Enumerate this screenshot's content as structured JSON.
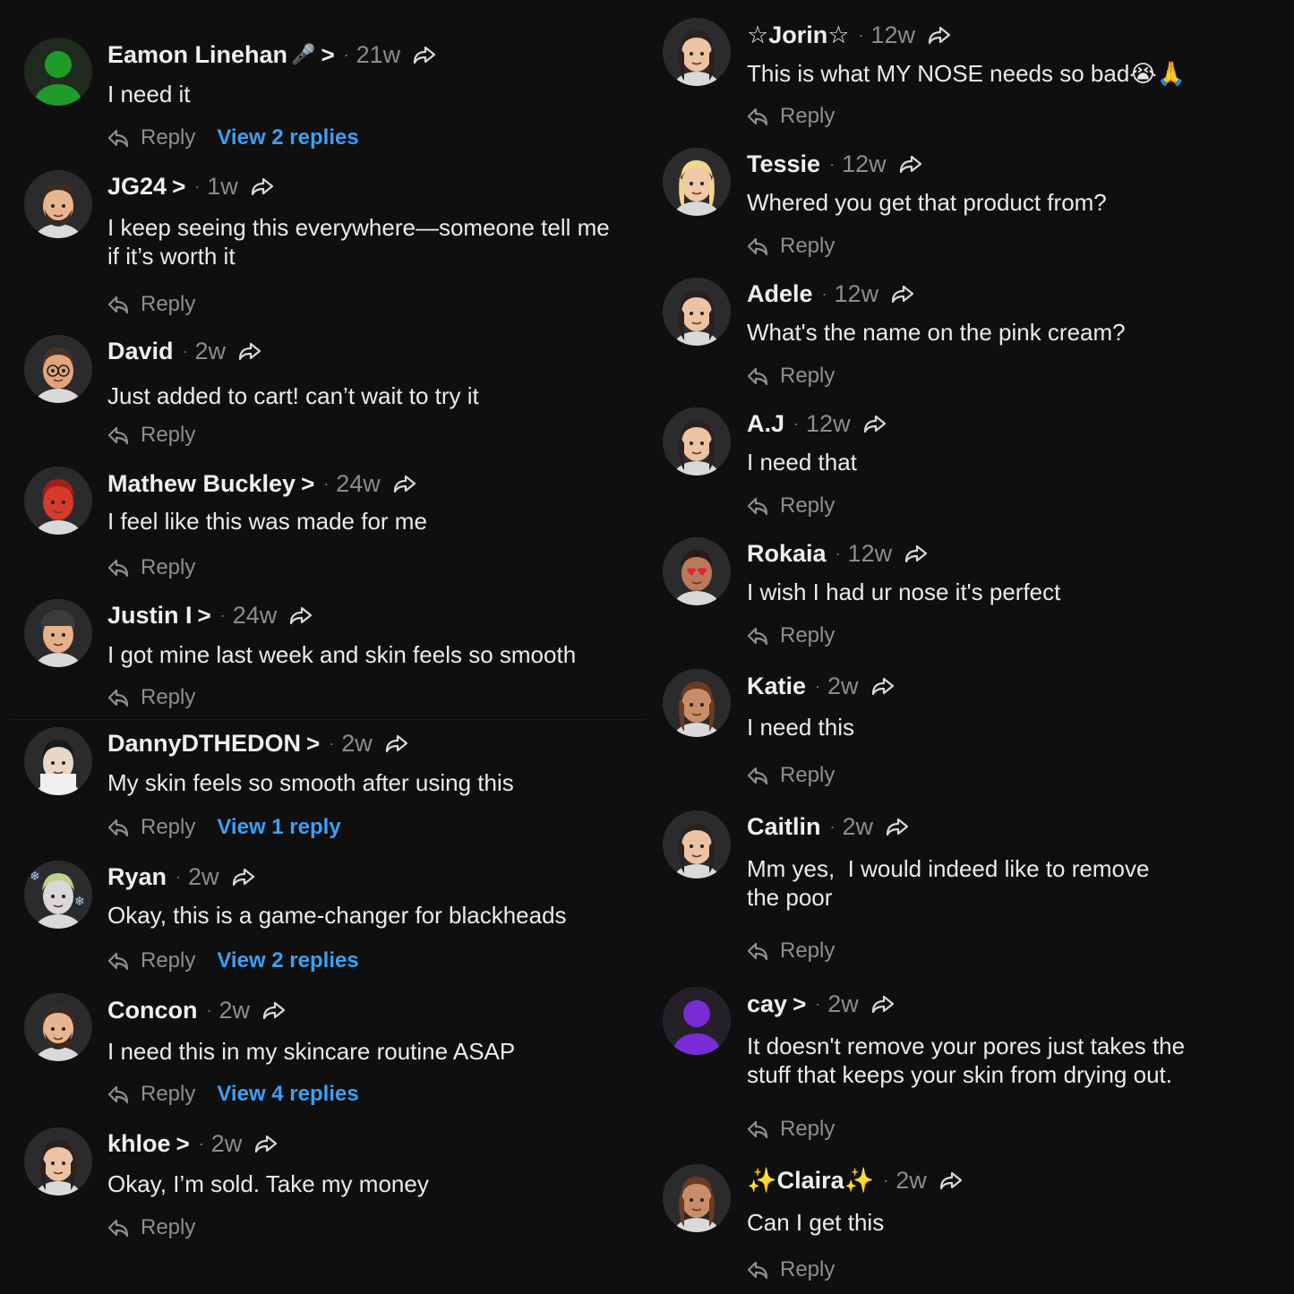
{
  "actions": {
    "reply_label": "Reply"
  },
  "colors": {
    "background": "#0f0f10",
    "name": "#efefef",
    "muted": "#8e8e92",
    "link": "#3ba0f5"
  },
  "left_comments": [
    {
      "name": "Eamon Linehan",
      "badge": "🎤",
      "chevron": ">",
      "time": "21w",
      "text": "I need it",
      "view_label": "View 2 replies",
      "avatar": "green-silhouette"
    },
    {
      "name": "JG24",
      "chevron": ">",
      "time": "1w",
      "text": "I keep seeing this everywhere—someone tell me\nif it’s worth it",
      "avatar": "bearded-man"
    },
    {
      "name": "David",
      "time": "2w",
      "text": "Just added to cart! can’t wait to try it",
      "avatar": "man-glasses"
    },
    {
      "name": "Mathew Buckley",
      "chevron": ">",
      "time": "24w",
      "text": "I feel like this was made for me",
      "avatar": "red-avatar"
    },
    {
      "name": "Justin I",
      "chevron": ">",
      "time": "24w",
      "text": "I got mine last week and skin feels so smooth",
      "avatar": "man-cap"
    },
    {
      "name": "DannyDTHEDON",
      "chevron": ">",
      "time": "2w",
      "text": "My skin feels so smooth after using this",
      "view_label": "View 1 reply",
      "avatar": "photo-man"
    },
    {
      "name": "Ryan",
      "time": "2w",
      "text": "Okay, this is a game-changer for blackheads",
      "view_label": "View 2 replies",
      "avatar": "snow-avatar"
    },
    {
      "name": "Concon",
      "time": "2w",
      "text": "I need this in my skincare routine ASAP",
      "view_label": "View 4 replies",
      "avatar": "bearded-man"
    },
    {
      "name": "khloe",
      "chevron": ">",
      "time": "2w",
      "text": "Okay, I’m sold. Take my money",
      "avatar": "woman-dark-hair"
    }
  ],
  "right_comments": [
    {
      "name": "☆Jorin☆",
      "time": "12w",
      "text": "This is what MY NOSE needs so bad😭🙏",
      "avatar": "woman-dark-hair"
    },
    {
      "name": "Tessie",
      "time": "12w",
      "text": "Whered you get that product from?",
      "avatar": "woman-blonde"
    },
    {
      "name": "Adele",
      "time": "12w",
      "text": "What's the name on the pink cream?",
      "avatar": "woman-dark-hair"
    },
    {
      "name": "A.J",
      "time": "12w",
      "text": "I need that",
      "avatar": "woman-dark-hair"
    },
    {
      "name": "Rokaia",
      "time": "12w",
      "text": "I wish I had ur nose it's perfect",
      "avatar": "heart-eyes"
    },
    {
      "name": "Katie",
      "time": "2w",
      "text": "I need this",
      "avatar": "woman-brown"
    },
    {
      "name": "Caitlin",
      "time": "2w",
      "text": "Mm yes,  I would indeed like to remove\nthe poor",
      "avatar": "woman-dark-hair"
    },
    {
      "name": "cay",
      "chevron": ">",
      "time": "2w",
      "text": "It doesn't remove your pores just takes the\nstuff that keeps your skin from drying out.",
      "avatar": "purple-silhouette"
    },
    {
      "name": "✨Claira✨",
      "time": "2w",
      "text": "Can I get this",
      "avatar": "woman-brown"
    }
  ]
}
